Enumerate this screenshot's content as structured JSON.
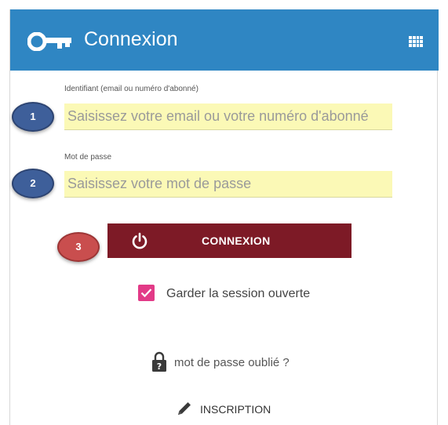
{
  "header": {
    "title": "Connexion",
    "icon_left": "key-icon",
    "icon_right": "grid-icon",
    "color": "#2f86c3"
  },
  "form": {
    "identifier": {
      "label": "Identifiant (email ou numéro d'abonné)",
      "placeholder": "Saisissez votre email ou votre numéro d'abonné",
      "value": ""
    },
    "password": {
      "label": "Mot de passe",
      "placeholder": "Saisissez votre mot de passe",
      "value": ""
    },
    "submit": {
      "label": "CONNEXION",
      "icon": "power-icon",
      "color": "#7d1a26"
    },
    "keep_session": {
      "label": "Garder la session ouverte",
      "checked": true,
      "color": "#e23a87"
    }
  },
  "links": {
    "forgot": {
      "label": "mot de passe oublié ?",
      "icon": "lock-question-icon"
    },
    "signup": {
      "label": "INSCRIPTION",
      "icon": "pencil-icon"
    }
  },
  "annotations": [
    {
      "label": "1",
      "color": "#3e5f9a"
    },
    {
      "label": "2",
      "color": "#3e5f9a"
    },
    {
      "label": "3",
      "color": "#c94e4e"
    }
  ]
}
